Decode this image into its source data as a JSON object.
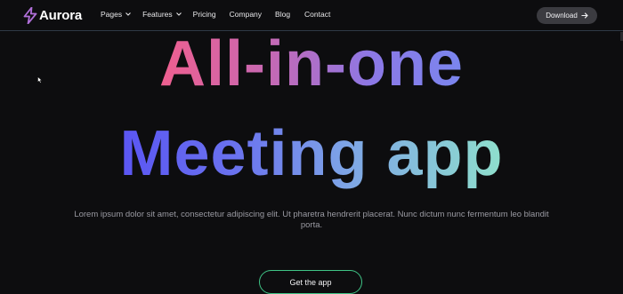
{
  "brand": {
    "name": "Aurora",
    "icon": "lightning-bolt-icon",
    "icon_color": "#b06fd8"
  },
  "nav": {
    "items": [
      {
        "label": "Pages",
        "has_dropdown": true
      },
      {
        "label": "Features",
        "has_dropdown": true
      },
      {
        "label": "Pricing",
        "has_dropdown": false
      },
      {
        "label": "Company",
        "has_dropdown": false
      },
      {
        "label": "Blog",
        "has_dropdown": false
      },
      {
        "label": "Contact",
        "has_dropdown": false
      }
    ],
    "download_label": "Download",
    "download_icon": "arrow-right-icon"
  },
  "hero": {
    "line1": "All-in-one",
    "line2": "Meeting app",
    "subtitle": "Lorem ipsum dolor sit amet, consectetur adipiscing elit. Ut pharetra hendrerit placerat. Nunc dictum nunc fermentum leo blandit porta.",
    "cta_label": "Get the app"
  },
  "colors": {
    "background": "#0d0d0f",
    "cta_border": "#3fc486",
    "gradient_line1": [
      "#ef5f8f",
      "#7a86ef"
    ],
    "gradient_line2": [
      "#5a55f2",
      "#8fe0cc"
    ]
  }
}
